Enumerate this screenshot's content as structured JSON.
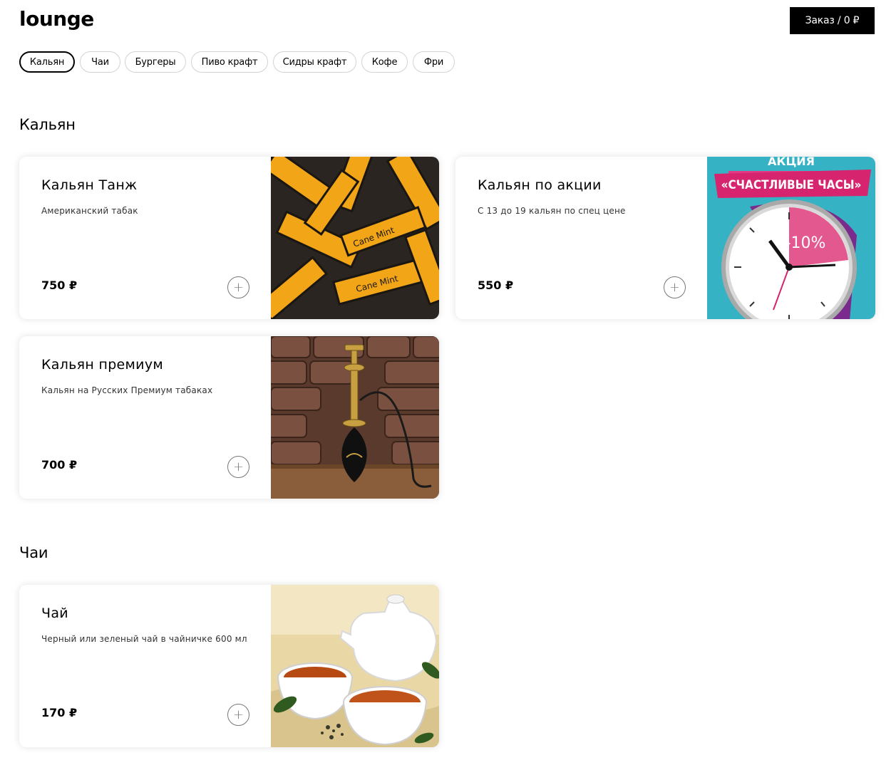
{
  "header": {
    "brand": "lounge",
    "order_label": "Заказ / 0 ₽"
  },
  "tabs": [
    "Кальян",
    "Чаи",
    "Бургеры",
    "Пиво крафт",
    "Сидры крафт",
    "Кофе",
    "Фри"
  ],
  "sections": [
    {
      "title": "Кальян",
      "items": [
        {
          "name": "Кальян Танж",
          "description": "Американский табак",
          "price": "750 ₽",
          "image": "tangiers-tobacco-packs",
          "image_text": [
            "Cane Mint"
          ]
        },
        {
          "name": "Кальян по акции",
          "description": "С 13 до 19 кальян по спец цене",
          "price": "550 ₽",
          "image": "happy-hours-clock",
          "image_text": [
            "АКЦИЯ",
            "«СЧАСТЛИВЫЕ ЧАСЫ»",
            "-10%"
          ]
        },
        {
          "name": "Кальян премиум",
          "description": "Кальян на Русских Премиум табаках",
          "price": "700 ₽",
          "image": "hookah-brick-wall"
        }
      ]
    },
    {
      "title": "Чаи",
      "items": [
        {
          "name": "Чай",
          "description": "Черный или зеленый чай в чайничке 600 мл",
          "price": "170 ₽",
          "image": "teapot-cups"
        }
      ]
    }
  ],
  "add_icon": "+",
  "colors": {
    "accent": "#000000",
    "border": "#d3d3d3"
  }
}
